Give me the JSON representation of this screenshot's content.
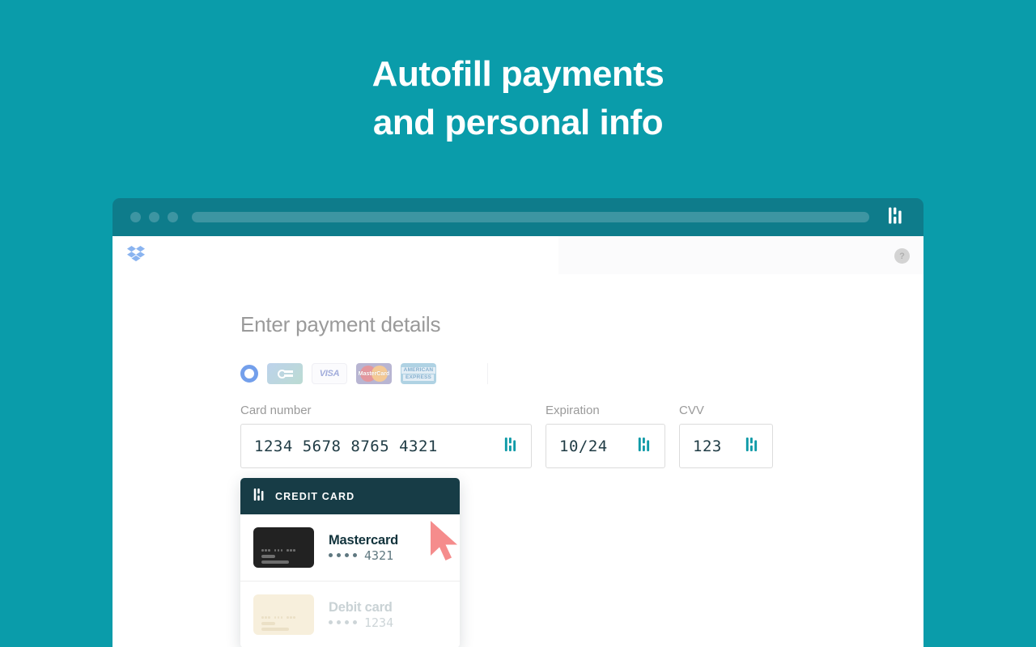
{
  "hero": {
    "line1": "Autofill payments",
    "line2": "and personal info"
  },
  "colors": {
    "background_teal": "#0A9CAA",
    "chrome_teal": "#0E7C8B",
    "chrome_accent": "#3D95A2",
    "dropdown_header": "#173C46",
    "field_text": "#1F3B44",
    "onepassword_teal": "#0E9AA7",
    "cursor_pink": "#F58C8C",
    "dropbox_blue": "#8AB4F0"
  },
  "browser": {
    "traffic_lights": [
      "close",
      "minimize",
      "maximize"
    ],
    "address_bar_value": "",
    "extension_icon": "1password-icon"
  },
  "page_header": {
    "logo": "dropbox-logo",
    "avatar_initial": "?"
  },
  "form": {
    "title": "Enter payment details",
    "card_brands": [
      {
        "name": "selected-radio",
        "label": ""
      },
      {
        "name": "cb-card",
        "label": "CB"
      },
      {
        "name": "visa",
        "label": "VISA"
      },
      {
        "name": "mastercard",
        "label": "MasterCard"
      },
      {
        "name": "amex",
        "label_line1": "AMERICAN",
        "label_line2": "EXPRESS"
      }
    ],
    "fields": [
      {
        "key": "card_number",
        "label": "Card number",
        "value": "1234  5678  8765  4321",
        "icon": "1password-icon"
      },
      {
        "key": "expiration",
        "label": "Expiration",
        "value": "10/24",
        "icon": "1password-icon"
      },
      {
        "key": "cvv",
        "label": "CVV",
        "value": "123",
        "icon": "1password-icon"
      }
    ]
  },
  "autofill": {
    "header_title": "CREDIT CARD",
    "header_icon": "1password-icon",
    "items": [
      {
        "title": "Mastercard",
        "masked_digits": "4321",
        "mask_dot_count": 4,
        "thumbnail": "dark-card-thumbnail",
        "disabled": false
      },
      {
        "title": "Debit card",
        "masked_digits": "1234",
        "mask_dot_count": 4,
        "thumbnail": "cream-card-thumbnail",
        "disabled": true
      }
    ]
  },
  "cursor": {
    "icon": "mouse-pointer-icon"
  }
}
